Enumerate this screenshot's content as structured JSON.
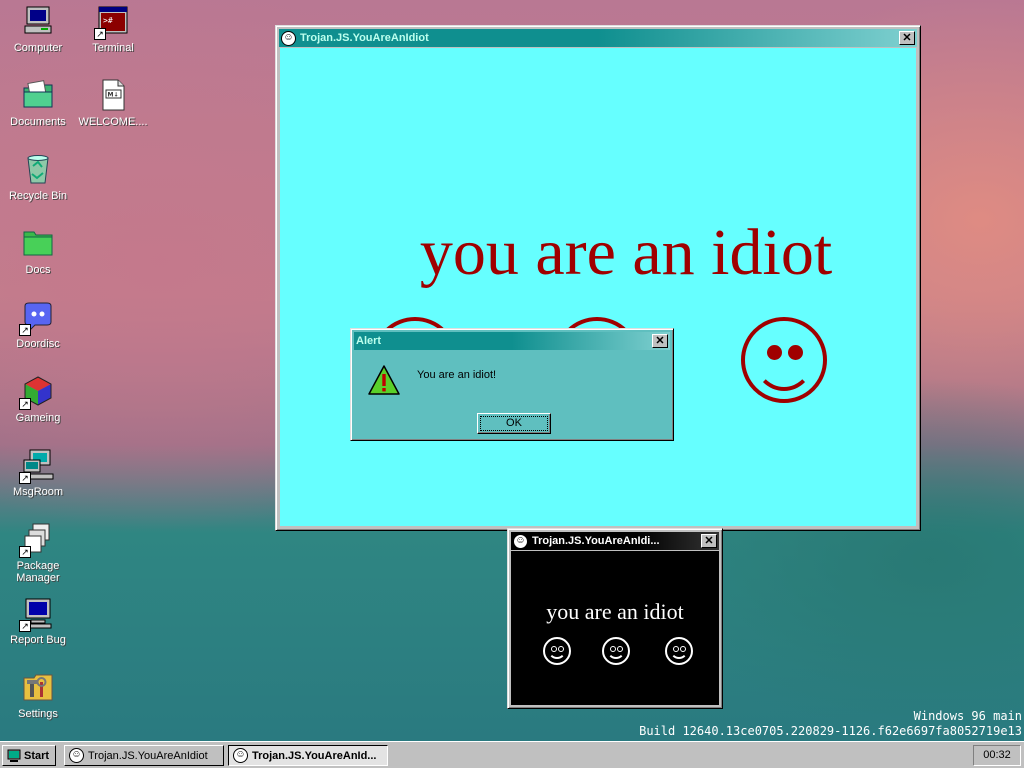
{
  "desktop": {
    "icons": [
      {
        "label": "Computer"
      },
      {
        "label": "Terminal"
      },
      {
        "label": "Documents"
      },
      {
        "label": "WELCOME...."
      },
      {
        "label": "Recycle Bin"
      },
      {
        "label": "Docs"
      },
      {
        "label": "Doordisc"
      },
      {
        "label": "Gameing"
      },
      {
        "label": "MsgRoom"
      },
      {
        "label": "Package Manager"
      },
      {
        "label": "Report Bug"
      },
      {
        "label": "Settings"
      }
    ],
    "watermark_line1": "Windows 96 main",
    "watermark_line2": "Build 12640.13ce0705.220829-1126.f62e6697fa8052719e13"
  },
  "main_window": {
    "title": "Trojan.JS.YouAreAnIdiot",
    "message": "you are an idiot",
    "bg_color": "#66ffff",
    "text_color": "#a00000"
  },
  "alert": {
    "title": "Alert",
    "message": "You are an idiot!",
    "ok_label": "OK",
    "bg_color": "#5fbfbf"
  },
  "small_window": {
    "title": "Trojan.JS.YouAreAnIdi...",
    "message": "you are an idiot"
  },
  "taskbar": {
    "start_label": "Start",
    "tasks": [
      {
        "label": "Trojan.JS.YouAreAnIdiot"
      },
      {
        "label": "Trojan.JS.YouAreAnId..."
      }
    ],
    "clock": "00:32"
  },
  "icons": {
    "window_icon": "smiley-icon",
    "alert_icon": "warning-icon",
    "close_glyph": "✕",
    "smile_glyph": "☺"
  }
}
